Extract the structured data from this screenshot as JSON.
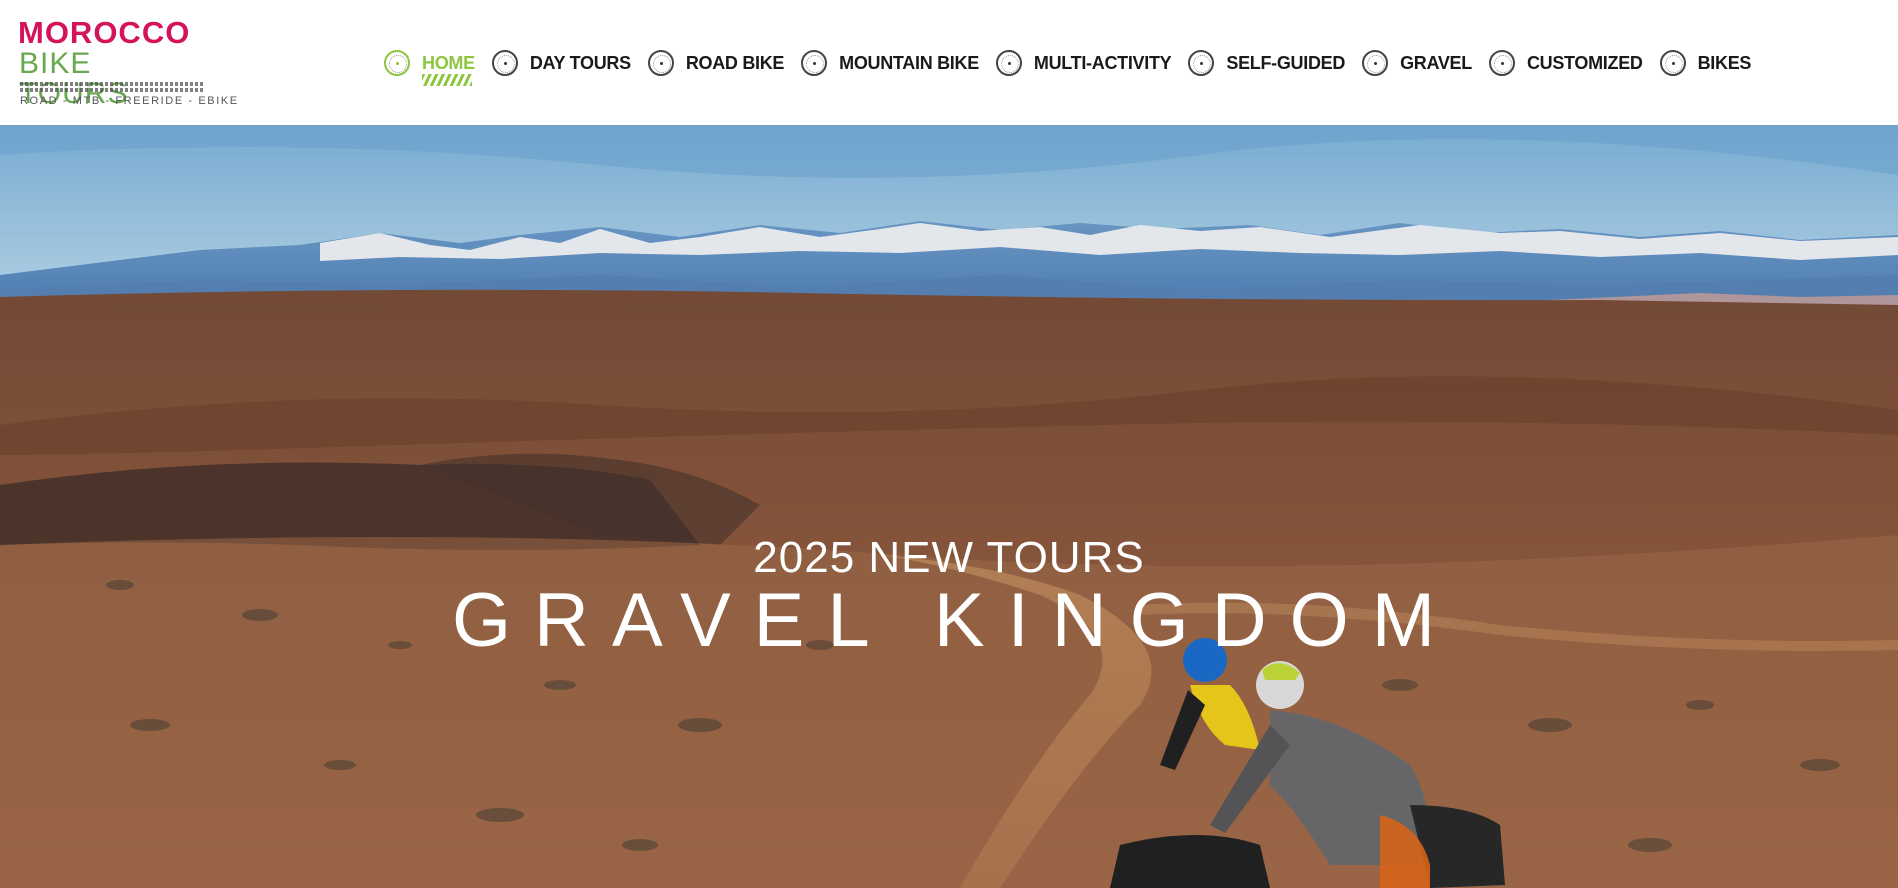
{
  "logo": {
    "line1": "MOROCCO",
    "line2": "BIKE TOURS",
    "tagline": "ROAD - MTB - FREERIDE - EBIKE"
  },
  "nav": {
    "items": [
      {
        "label": "HOME",
        "active": true
      },
      {
        "label": "DAY TOURS",
        "active": false
      },
      {
        "label": "ROAD BIKE",
        "active": false
      },
      {
        "label": "MOUNTAIN BIKE",
        "active": false
      },
      {
        "label": "MULTI-ACTIVITY",
        "active": false
      },
      {
        "label": "SELF-GUIDED",
        "active": false
      },
      {
        "label": "GRAVEL",
        "active": false
      },
      {
        "label": "CUSTOMIZED",
        "active": false
      },
      {
        "label": "BIKES",
        "active": false
      }
    ]
  },
  "hero": {
    "subtitle": "2025 NEW TOURS",
    "title": "GRAVEL KINGDOM"
  },
  "colors": {
    "brand_red": "#d4145a",
    "brand_green": "#6aa84f",
    "nav_active": "#8dc63f",
    "nav_text": "#1a1a1a"
  }
}
